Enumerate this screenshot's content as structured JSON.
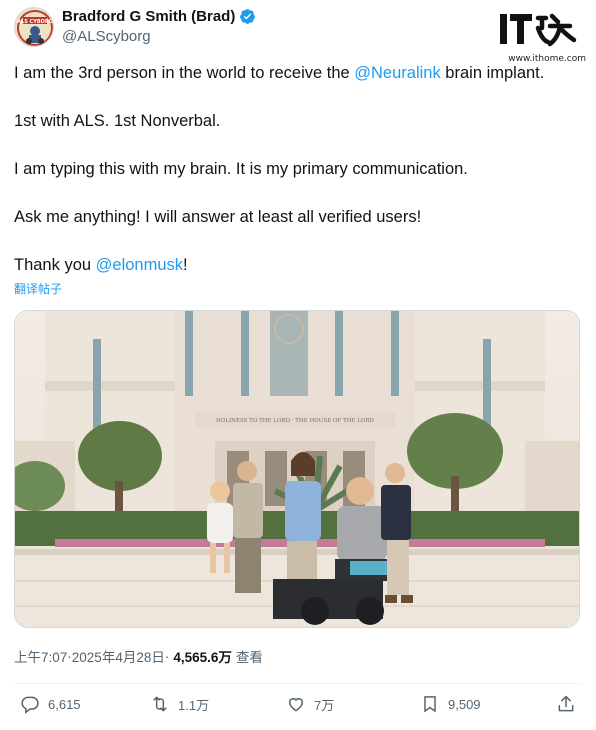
{
  "author": {
    "display_name": "Bradford G Smith (Brad)",
    "handle": "@ALScyborg",
    "avatar_text": "ALS CYBORG"
  },
  "watermark": {
    "logo_text": "IT之家",
    "url": "www.ithome.com"
  },
  "tweet": {
    "line1_prefix": "I am the 3rd person in the world to receive the ",
    "line1_mention": "@Neuralink",
    "line1_suffix": " brain implant.",
    "line2": "1st with ALS. 1st Nonverbal.",
    "line3": "I am typing this with my brain. It is my primary communication.",
    "line4": "Ask me anything! I will answer at least all verified users!",
    "line5_prefix": "Thank you ",
    "line5_mention": "@elonmusk",
    "line5_suffix": "!"
  },
  "translate_label": "翻译帖子",
  "photo": {
    "temple_inscription": "HOLINESS TO THE LORD · THE HOUSE OF THE LORD"
  },
  "meta": {
    "time": "上午7:07",
    "separator": " · ",
    "date": "2025年4月28日",
    "views_count": "4,565.6万",
    "views_label": "查看"
  },
  "actions": {
    "replies": "6,615",
    "reposts": "1.1万",
    "likes": "7万",
    "bookmarks": "9,509"
  },
  "colors": {
    "accent": "#1d9bf0",
    "secondary_text": "#536471",
    "primary_text": "#0f1419"
  }
}
